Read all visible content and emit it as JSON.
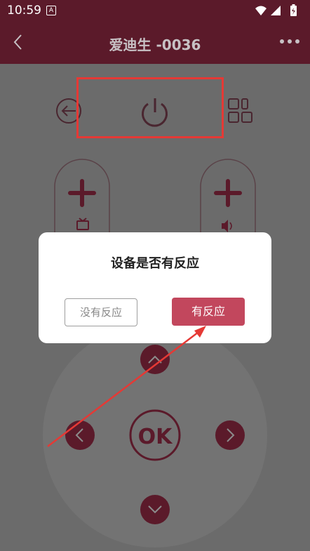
{
  "status": {
    "time": "10:59",
    "app_badge": "A"
  },
  "nav": {
    "title": "爱迪生 -0036"
  },
  "dialog": {
    "question": "设备是否有反应",
    "no_label": "没有反应",
    "yes_label": "有反应"
  },
  "dpad": {
    "ok_label": "OK"
  },
  "colors": {
    "brand": "#5b1a2a",
    "accent": "#c2475d",
    "annotation": "#e53935"
  }
}
